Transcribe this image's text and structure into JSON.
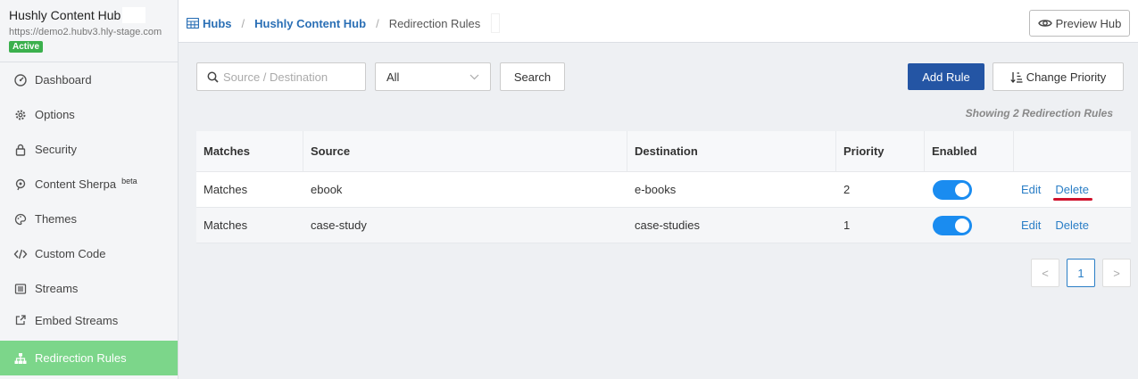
{
  "sidebar": {
    "hub_name": "Hushly Content Hub",
    "hub_url": "https://demo2.hubv3.hly-stage.com",
    "status_badge": "Active",
    "items": [
      {
        "label": "Dashboard",
        "icon": "dashboard-icon"
      },
      {
        "label": "Options",
        "icon": "gear-icon"
      },
      {
        "label": "Security",
        "icon": "lock-icon"
      },
      {
        "label": "Content Sherpa",
        "icon": "sherpa-icon",
        "tag": "beta"
      },
      {
        "label": "Themes",
        "icon": "palette-icon"
      },
      {
        "label": "Custom Code",
        "icon": "code-icon"
      },
      {
        "label": "Streams",
        "icon": "list-icon"
      },
      {
        "label": "Embed Streams",
        "icon": "share-icon"
      },
      {
        "label": "Redirection Rules",
        "icon": "sitemap-icon",
        "active": true
      }
    ]
  },
  "breadcrumb": {
    "items": [
      "Hubs",
      "Hushly Content Hub",
      "Redirection Rules"
    ]
  },
  "header": {
    "preview_label": "Preview Hub"
  },
  "toolbar": {
    "search_placeholder": "Source / Destination",
    "filter_value": "All",
    "search_label": "Search",
    "add_label": "Add Rule",
    "priority_label": "Change Priority",
    "showing_text": "Showing 2 Redirection Rules"
  },
  "table": {
    "headers": [
      "Matches",
      "Source",
      "Destination",
      "Priority",
      "Enabled",
      ""
    ],
    "rows": [
      {
        "matches": "Matches",
        "source": "ebook",
        "destination": "e-books",
        "priority": "2",
        "enabled": true,
        "edit": "Edit",
        "delete": "Delete"
      },
      {
        "matches": "Matches",
        "source": "case-study",
        "destination": "case-studies",
        "priority": "1",
        "enabled": true,
        "edit": "Edit",
        "delete": "Delete"
      }
    ]
  },
  "pagination": {
    "prev": "<",
    "page": "1",
    "next": ">"
  },
  "colors": {
    "primary": "#2455a4",
    "active_nav": "#7cd68a",
    "toggle_on": "#1a8cf0",
    "link": "#2a7ec6",
    "badge": "#3bb04d"
  }
}
